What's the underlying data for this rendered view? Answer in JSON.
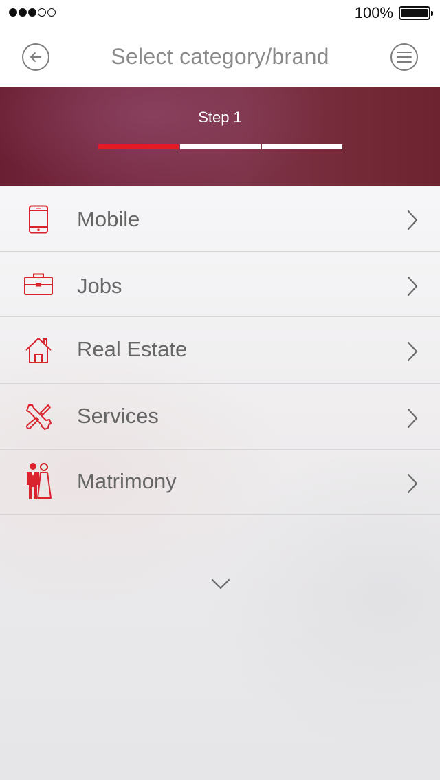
{
  "status_bar": {
    "battery_percent": "100%",
    "signal_dots_filled": 3,
    "signal_dots_total": 5
  },
  "header": {
    "title": "Select category/brand",
    "back_icon": "arrow-left-circle-icon",
    "menu_icon": "hamburger-circle-icon"
  },
  "step": {
    "label": "Step 1",
    "current": 1,
    "total": 3
  },
  "categories": [
    {
      "label": "Mobile",
      "icon": "mobile-phone-icon"
    },
    {
      "label": "Jobs",
      "icon": "briefcase-icon"
    },
    {
      "label": "Real Estate",
      "icon": "house-icon"
    },
    {
      "label": "Services",
      "icon": "tools-icon"
    },
    {
      "label": "Matrimony",
      "icon": "wedding-couple-icon"
    }
  ],
  "colors": {
    "accent": "#e31b23",
    "banner": "#7a2c45",
    "text": "#666666"
  }
}
